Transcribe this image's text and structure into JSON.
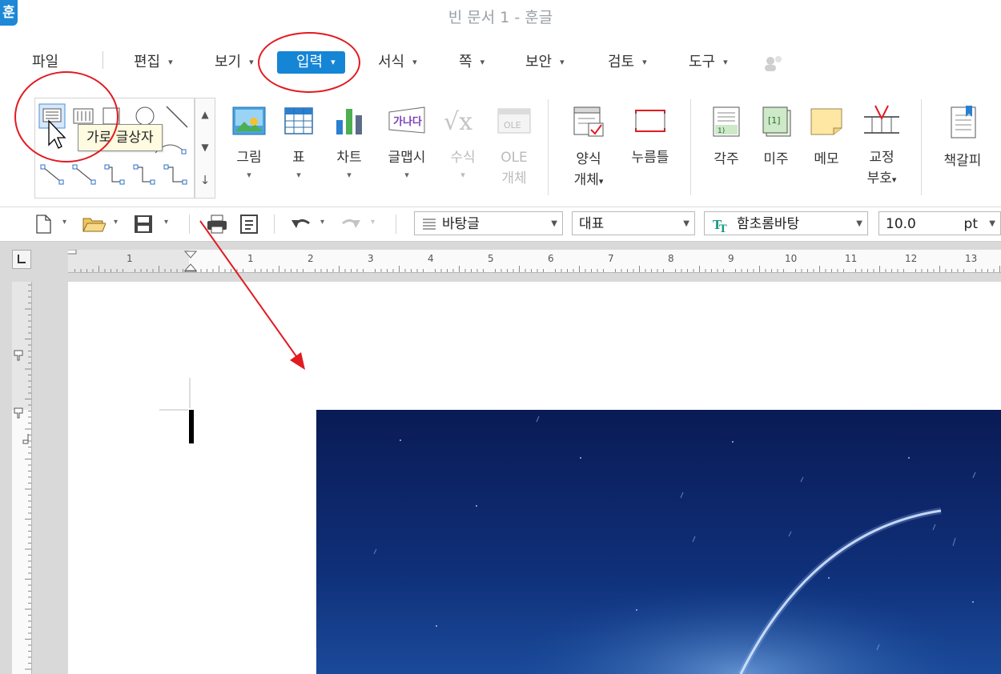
{
  "window": {
    "app_badge": "훈",
    "title": "빈 문서 1 - 훈글"
  },
  "menu": {
    "items": [
      {
        "label": "파일"
      },
      {
        "label": "편집"
      },
      {
        "label": "보기"
      },
      {
        "label": "입력",
        "active": true
      },
      {
        "label": "서식"
      },
      {
        "label": "쪽"
      },
      {
        "label": "보안"
      },
      {
        "label": "검토"
      },
      {
        "label": "도구"
      }
    ]
  },
  "ribbon": {
    "tooltip": "가로 글상자",
    "buttons": {
      "picture": "그림",
      "table": "표",
      "chart": "차트",
      "wordart": "글맵시",
      "formula": "수식",
      "ole_line1": "OLE",
      "ole_line2": "개체",
      "form_line1": "양식",
      "form_line2": "개체",
      "press_frame": "누름틀",
      "footnote": "각주",
      "endnote": "미주",
      "memo": "메모",
      "proof_line1": "교정",
      "proof_line2": "부호",
      "bookmark": "책갈피",
      "wordart_icon_text": "가나다",
      "ole_icon_text": "OLE",
      "endnote_icon_text": "[1]",
      "footnote_icon_text": "1)"
    }
  },
  "toolbar": {
    "style_combo": "바탕글",
    "outline_combo": "대표",
    "font_combo": "함초롬바탕",
    "font_size": "10.0",
    "size_unit": "pt"
  },
  "ruler": {
    "h_numbers": [
      "1",
      "1",
      "2",
      "3",
      "4",
      "5",
      "6",
      "7",
      "8",
      "9",
      "10",
      "11",
      "12",
      "13"
    ]
  },
  "colors": {
    "accent": "#1585d6",
    "annotation": "#e11b22",
    "night_sky": "#0c1f5e"
  }
}
